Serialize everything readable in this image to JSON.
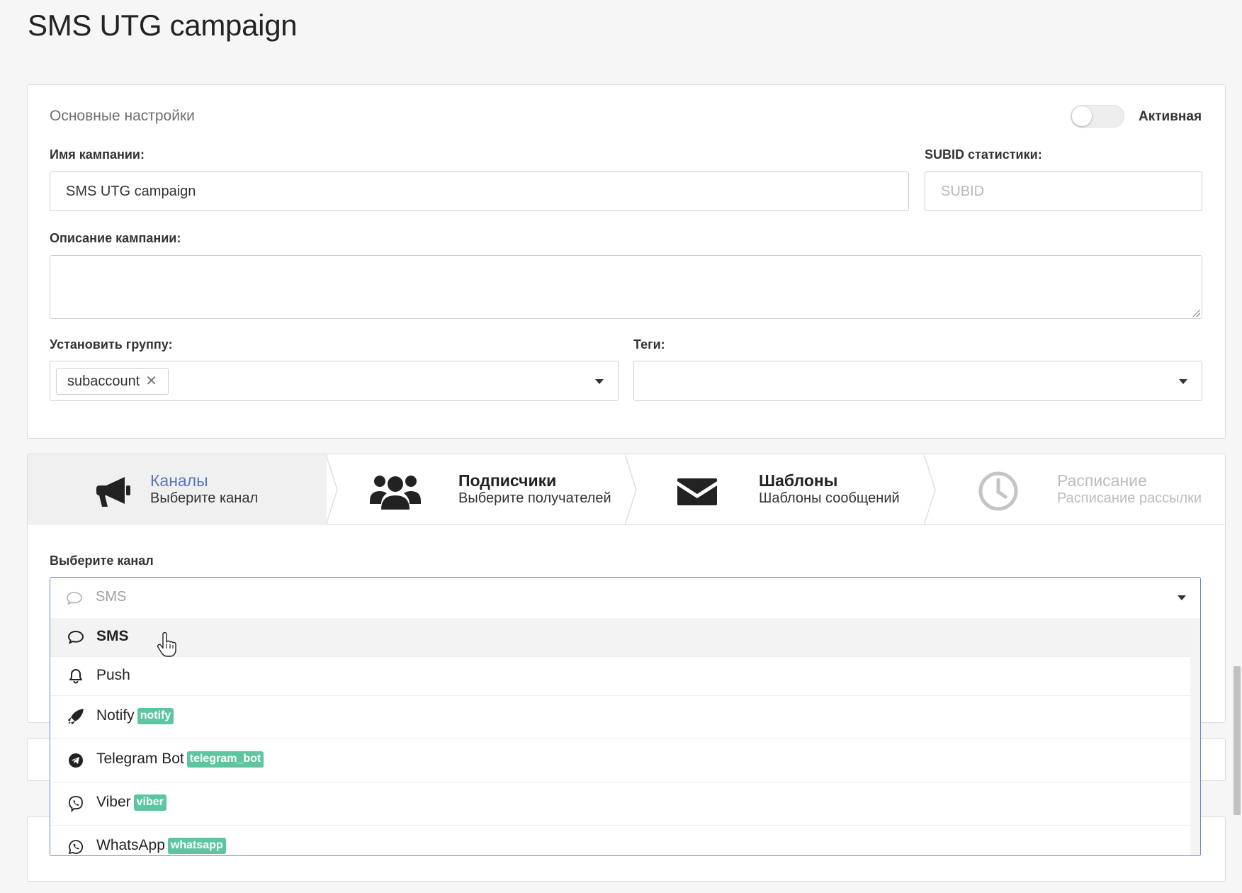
{
  "page": {
    "title": "SMS UTG campaign"
  },
  "settings": {
    "section_title": "Основные настройки",
    "active_label": "Активная",
    "active": false,
    "name_label": "Имя кампании:",
    "name_value": "SMS UTG campaign",
    "subid_label": "SUBID статистики:",
    "subid_placeholder": "SUBID",
    "description_label": "Описание кампании:",
    "group_label": "Установить группу:",
    "group_chip": "subaccount",
    "tags_label": "Теги:"
  },
  "wizard": {
    "steps": [
      {
        "title": "Каналы",
        "subtitle": "Выберите канал",
        "icon": "megaphone-icon",
        "state": "active"
      },
      {
        "title": "Подписчики",
        "subtitle": "Выберите получателей",
        "icon": "users-icon",
        "state": "normal"
      },
      {
        "title": "Шаблоны",
        "subtitle": "Шаблоны сообщений",
        "icon": "envelope-icon",
        "state": "normal"
      },
      {
        "title": "Расписание",
        "subtitle": "Расписание рассылки",
        "icon": "clock-icon",
        "state": "disabled"
      }
    ],
    "channel_label": "Выберите канал"
  },
  "channel_select": {
    "selected": "SMS",
    "options": [
      {
        "label": "SMS",
        "tag": "",
        "icon": "chat-bubble-icon"
      },
      {
        "label": "Push",
        "tag": "",
        "icon": "bell-icon"
      },
      {
        "label": "Notify",
        "tag": "notify",
        "icon": "rocket-icon"
      },
      {
        "label": "Telegram Bot",
        "tag": "telegram_bot",
        "icon": "telegram-icon"
      },
      {
        "label": "Viber",
        "tag": "viber",
        "icon": "viber-icon"
      },
      {
        "label": "WhatsApp",
        "tag": "whatsapp",
        "icon": "whatsapp-icon"
      }
    ]
  },
  "colors": {
    "accent": "#5a74c0",
    "tag": "#5cc6a0",
    "focus_border": "#6b85c8"
  }
}
